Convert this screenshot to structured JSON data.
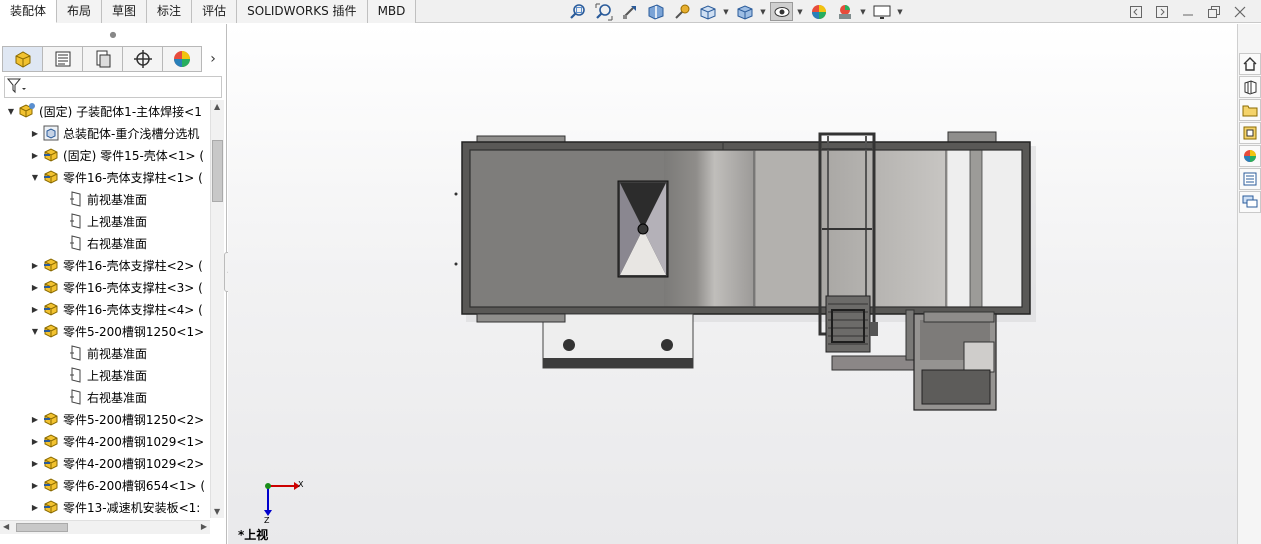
{
  "command_tabs": [
    "装配体",
    "布局",
    "草图",
    "标注",
    "评估",
    "SOLIDWORKS 插件",
    "MBD"
  ],
  "view_toolbar_icons": [
    "zoom-to-fit-icon",
    "zoom-to-area-icon",
    "previous-view-icon",
    "section-view-icon",
    "dynamic-annotation-icon",
    "view-orientation-icon",
    "display-style-icon",
    "hide-show-items-icon",
    "edit-appearance-icon",
    "apply-scene-icon",
    "view-settings-icon"
  ],
  "manager_tabs": [
    "featuremanager-icon",
    "propertymanager-icon",
    "configurationmanager-icon",
    "dimxpertmanager-icon",
    "displaymanager-icon"
  ],
  "tree_items": [
    {
      "label": "(固定) 子装配体1-主体焊接<1",
      "level": 0,
      "state": "expanded",
      "icon": "subassembly-icon"
    },
    {
      "label": "总装配体-重介浅槽分选机",
      "level": 1,
      "state": "collapsed",
      "icon": "assembly-doc-icon"
    },
    {
      "label": "(固定) 零件15-壳体<1> (",
      "level": 1,
      "state": "collapsed",
      "icon": "part-icon"
    },
    {
      "label": "零件16-壳体支撑柱<1> (",
      "level": 1,
      "state": "expanded",
      "icon": "part-icon"
    },
    {
      "label": "前视基准面",
      "level": 2,
      "state": "none",
      "icon": "plane-icon"
    },
    {
      "label": "上视基准面",
      "level": 2,
      "state": "none",
      "icon": "plane-icon"
    },
    {
      "label": "右视基准面",
      "level": 2,
      "state": "none",
      "icon": "plane-icon"
    },
    {
      "label": "零件16-壳体支撑柱<2> (",
      "level": 1,
      "state": "collapsed",
      "icon": "part-icon"
    },
    {
      "label": "零件16-壳体支撑柱<3> (",
      "level": 1,
      "state": "collapsed",
      "icon": "part-icon"
    },
    {
      "label": "零件16-壳体支撑柱<4> (",
      "level": 1,
      "state": "collapsed",
      "icon": "part-icon"
    },
    {
      "label": "零件5-200槽钢1250<1>",
      "level": 1,
      "state": "expanded",
      "icon": "part-icon"
    },
    {
      "label": "前视基准面",
      "level": 2,
      "state": "none",
      "icon": "plane-icon"
    },
    {
      "label": "上视基准面",
      "level": 2,
      "state": "none",
      "icon": "plane-icon"
    },
    {
      "label": "右视基准面",
      "level": 2,
      "state": "none",
      "icon": "plane-icon"
    },
    {
      "label": "零件5-200槽钢1250<2>",
      "level": 1,
      "state": "collapsed",
      "icon": "part-icon"
    },
    {
      "label": "零件4-200槽钢1029<1>",
      "level": 1,
      "state": "collapsed",
      "icon": "part-icon"
    },
    {
      "label": "零件4-200槽钢1029<2>",
      "level": 1,
      "state": "collapsed",
      "icon": "part-icon"
    },
    {
      "label": "零件6-200槽钢654<1> (",
      "level": 1,
      "state": "collapsed",
      "icon": "part-icon"
    },
    {
      "label": "零件13-减速机安装板<1:",
      "level": 1,
      "state": "collapsed",
      "icon": "part-icon"
    }
  ],
  "triad": {
    "x_label": "X",
    "z_label": "Z"
  },
  "view_label": "*上视",
  "task_pane_icons": [
    "home-icon",
    "design-library-icon",
    "file-explorer-icon",
    "view-palette-icon",
    "appearances-icon",
    "custom-properties-icon",
    "forum-icon"
  ]
}
